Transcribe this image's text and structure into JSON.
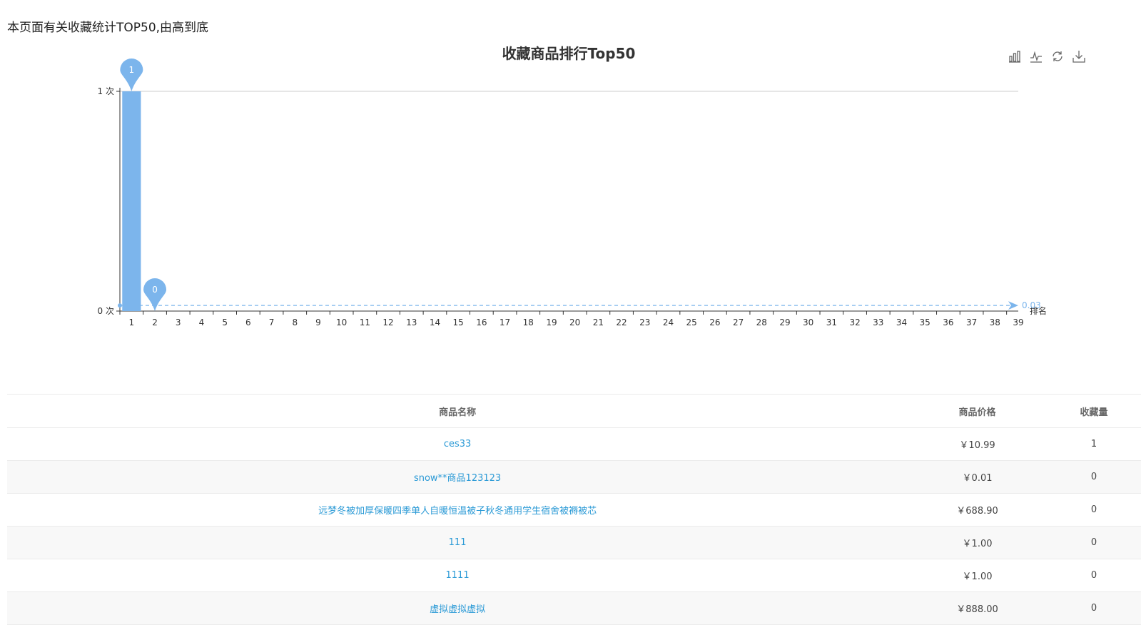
{
  "intro_text": "本页面有关收藏统计TOP50,由高到底",
  "colors": {
    "bar": "#7cb5ec",
    "axis": "#333333",
    "grid": "#cccccc",
    "link": "#2b9ad6"
  },
  "toolbox": {
    "icons": [
      "bar-chart-icon",
      "line-chart-icon",
      "refresh-icon",
      "download-icon"
    ]
  },
  "chart_data": {
    "type": "bar",
    "title": "收藏商品排行Top50",
    "xlabel": "排名",
    "ylabel": "",
    "categories": [
      "1",
      "2",
      "3",
      "4",
      "5",
      "6",
      "7",
      "8",
      "9",
      "10",
      "11",
      "12",
      "13",
      "14",
      "15",
      "16",
      "17",
      "18",
      "19",
      "20",
      "21",
      "22",
      "23",
      "24",
      "25",
      "26",
      "27",
      "28",
      "29",
      "30",
      "31",
      "32",
      "33",
      "34",
      "35",
      "36",
      "37",
      "38",
      "39"
    ],
    "values": [
      1,
      0,
      0,
      0,
      0,
      0,
      0,
      0,
      0,
      0,
      0,
      0,
      0,
      0,
      0,
      0,
      0,
      0,
      0,
      0,
      0,
      0,
      0,
      0,
      0,
      0,
      0,
      0,
      0,
      0,
      0,
      0,
      0,
      0,
      0,
      0,
      0,
      0,
      0
    ],
    "ylim": [
      0,
      1
    ],
    "yticks": [
      "0 次",
      "1 次"
    ],
    "max_pin": "1",
    "min_pin": "0",
    "markline_label": "0.03",
    "grid": true
  },
  "table": {
    "headers": [
      "商品名称",
      "商品价格",
      "收藏量"
    ],
    "rows": [
      {
        "name": "ces33",
        "price": "￥10.99",
        "count": "1"
      },
      {
        "name": "snow**商品123123",
        "price": "￥0.01",
        "count": "0"
      },
      {
        "name": "远梦冬被加厚保暖四季单人自暖恒温被子秋冬通用学生宿舍被褥被芯",
        "price": "￥688.90",
        "count": "0"
      },
      {
        "name": "111",
        "price": "￥1.00",
        "count": "0"
      },
      {
        "name": "1111",
        "price": "￥1.00",
        "count": "0"
      },
      {
        "name": "虚拟虚拟虚拟",
        "price": "￥888.00",
        "count": "0"
      }
    ]
  }
}
